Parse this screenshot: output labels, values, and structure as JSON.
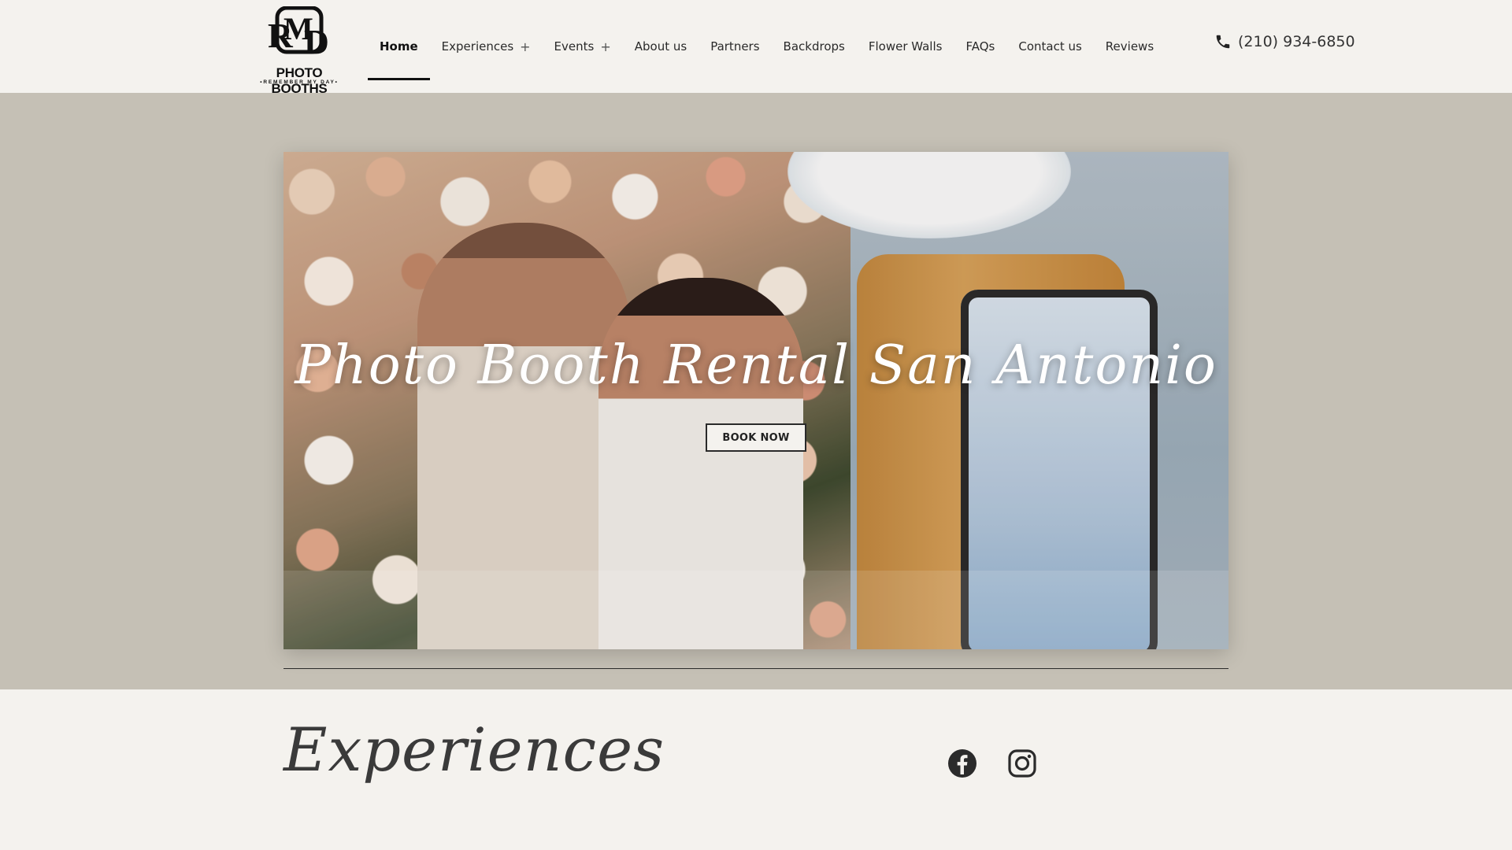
{
  "logo": {
    "line1": "PHOTO BOOTHS",
    "line2": "•REMEMBER MY DAY•"
  },
  "nav": {
    "items": [
      {
        "label": "Home",
        "active": true,
        "has_submenu": false
      },
      {
        "label": "Experiences",
        "active": false,
        "has_submenu": true
      },
      {
        "label": "Events",
        "active": false,
        "has_submenu": true
      },
      {
        "label": "About us",
        "active": false,
        "has_submenu": false
      },
      {
        "label": "Partners",
        "active": false,
        "has_submenu": false
      },
      {
        "label": "Backdrops",
        "active": false,
        "has_submenu": false
      },
      {
        "label": "Flower Walls",
        "active": false,
        "has_submenu": false
      },
      {
        "label": "FAQs",
        "active": false,
        "has_submenu": false
      },
      {
        "label": "Contact us",
        "active": false,
        "has_submenu": false
      },
      {
        "label": "Reviews",
        "active": false,
        "has_submenu": false
      }
    ],
    "submenu_indicator": "+"
  },
  "phone": {
    "icon": "phone-icon",
    "number": "(210) 934-6850"
  },
  "hero": {
    "title": "Photo Booth Rental San Antonio",
    "button_label": "BOOK NOW"
  },
  "section": {
    "title": "Experiences"
  },
  "social": {
    "facebook_icon": "facebook-icon",
    "instagram_icon": "instagram-icon"
  },
  "colors": {
    "page_bg": "#f4f2ee",
    "hero_band": "#c5c0b5",
    "text_dark": "#1a1a1a"
  }
}
